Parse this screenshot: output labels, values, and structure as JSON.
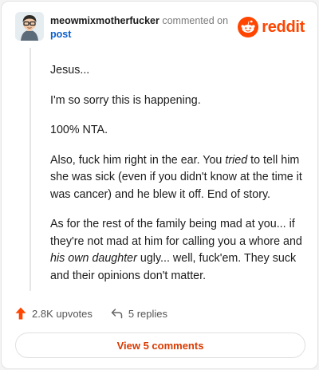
{
  "header": {
    "username": "meowmixmotherfucker",
    "action": "commented on",
    "post_link": "post",
    "logo_text": "reddit"
  },
  "comment": {
    "paragraphs": [
      "Jesus...",
      "I'm so sorry this is happening.",
      "100% NTA."
    ],
    "p4": {
      "a": "Also, fuck him right in the ear. You ",
      "em": "tried",
      "b": " to tell him she was sick (even if you didn't know at the time it was cancer) and he blew it off. End of story."
    },
    "p5": {
      "a": "As for the rest of the family being mad at you... if they're not mad at him for calling you a whore and ",
      "em": "his own daughter",
      "b": " ugly... well, fuck'em. They suck and their opinions don't matter."
    }
  },
  "footer": {
    "upvotes": "2.8K upvotes",
    "replies": "5 replies",
    "view_button": "View 5 comments"
  },
  "colors": {
    "reddit_orange": "#ff4500",
    "upvote": "#ff4500",
    "link": "#0b5fcf",
    "view_button_text": "#d93a00"
  },
  "icons": {
    "upvote": "upvote-arrow-icon",
    "reply": "reply-arrow-icon",
    "logo": "reddit-snoo-icon"
  }
}
